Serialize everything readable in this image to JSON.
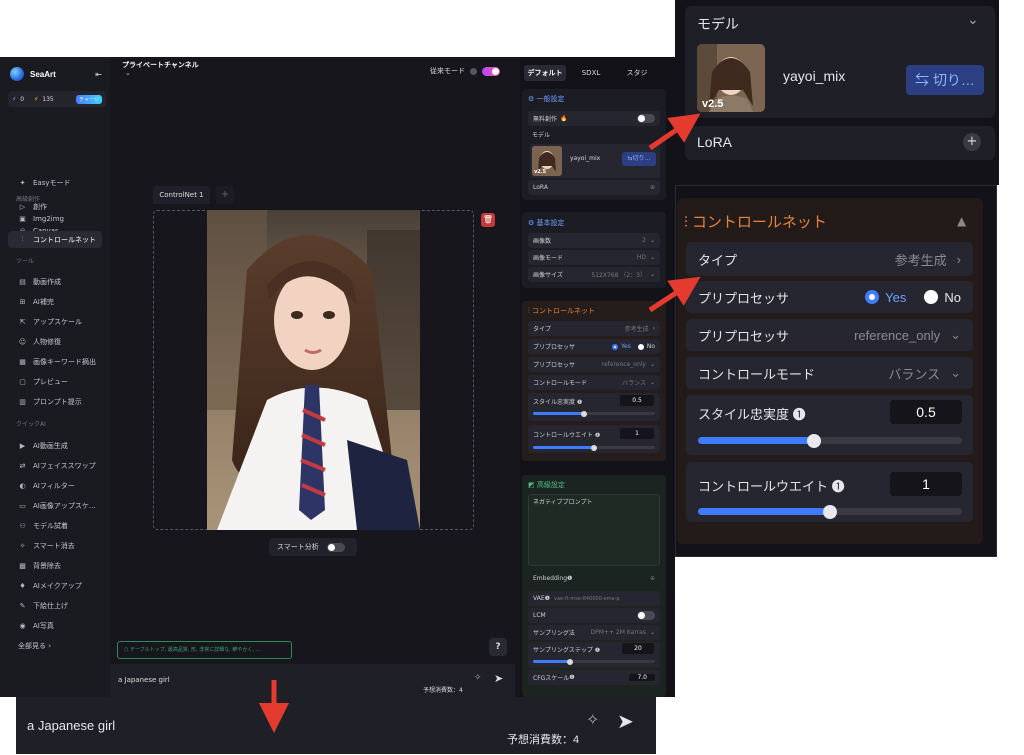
{
  "sidebar": {
    "brand": "SeaArt",
    "collapse_icon": "collapse-icon",
    "credits": {
      "a": "0",
      "b": "135",
      "charge": "チャージ"
    },
    "items": [
      {
        "label": "Easyモード",
        "icon": "sparkle-icon"
      },
      {
        "label": "創作",
        "icon": "play-icon"
      },
      {
        "label": "Canvas",
        "icon": "canvas-icon"
      }
    ],
    "section_advanced": "高級創作",
    "advanced_items": [
      {
        "label": "Img2img",
        "icon": "img2img-icon"
      },
      {
        "label": "コントロールネット",
        "icon": "sliders-icon"
      }
    ],
    "section_tools": "ツール",
    "tool_items": [
      {
        "label": "動画作成",
        "icon": "video-icon"
      },
      {
        "label": "AI補完",
        "icon": "expand-icon"
      },
      {
        "label": "アップスケール",
        "icon": "upscale-icon"
      },
      {
        "label": "人物修復",
        "icon": "face-icon"
      },
      {
        "label": "画像キーワード摘出",
        "icon": "keyword-icon"
      },
      {
        "label": "プレビュー",
        "icon": "preview-icon"
      },
      {
        "label": "プロンプト提示",
        "icon": "prompt-icon"
      }
    ],
    "section_quick": "クイックAI",
    "quick_items": [
      {
        "label": "AI動画生成",
        "icon": "video-gen-icon"
      },
      {
        "label": "AIフェイススワップ",
        "icon": "swap-icon"
      },
      {
        "label": "AIフィルター",
        "icon": "filter-icon"
      },
      {
        "label": "AI画像アップスケ…",
        "icon": "upscale-ai-icon"
      },
      {
        "label": "モデル試着",
        "icon": "shirt-icon"
      },
      {
        "label": "スマート消去",
        "icon": "eraser-icon"
      },
      {
        "label": "背景除去",
        "icon": "bg-remove-icon"
      },
      {
        "label": "AIメイクアップ",
        "icon": "makeup-icon"
      },
      {
        "label": "下絵仕上げ",
        "icon": "sketch-icon"
      },
      {
        "label": "AI写真",
        "icon": "camera-icon"
      }
    ],
    "see_all": "全部見る ›"
  },
  "topbar": {
    "channel": "プライベートチャンネル",
    "mode_label": "従来モード"
  },
  "canvas": {
    "tab_label": "ControlNet 1",
    "add_tab": "+",
    "smart_label": "スマート分析",
    "hint": "テーブルトップ, 最高品質, 形, 非常に詳細な, 鮮やかく, …",
    "help": "?"
  },
  "prompt": {
    "text": "a Japanese girl",
    "cost": "予想消費数：4"
  },
  "right_panel": {
    "tabs": [
      "デフォルト",
      "SDXL",
      "スタジ"
    ],
    "general": {
      "title": "一般設定",
      "free_label": "無料創作",
      "model_label": "モデル",
      "model_name": "yayoi_mix",
      "model_version": "v2.5",
      "switch_label": "切り…",
      "lora_label": "LoRA"
    },
    "basic": {
      "title": "基本設定",
      "rows": [
        {
          "label": "画像数",
          "value": "2"
        },
        {
          "label": "画像モード",
          "value": "HD"
        },
        {
          "label": "画像サイズ",
          "value": "512X768 （2：3）"
        }
      ]
    },
    "controlnet": {
      "title": "コントロールネット",
      "type_label": "タイプ",
      "type_value": "参考生成",
      "pre_label": "プリプロセッサ",
      "yes": "Yes",
      "no": "No",
      "pre2_label": "プリプロセッサ",
      "pre2_value": "reference_only",
      "mode_label": "コントロールモード",
      "mode_value": "バランス",
      "style_label": "スタイル忠実度",
      "style_value": "0.5",
      "style_level": 0.42,
      "weight_label": "コントロールウエイト",
      "weight_value": "1",
      "weight_level": 0.5
    },
    "advanced": {
      "title": "高級設定",
      "negative_label": "ネガティブプロンプト",
      "embedding_label": "Embedding",
      "vae_label": "VAE",
      "vae_value": "vae-ft-mse-840000-ema-p",
      "lcm_label": "LCM",
      "sampler_label": "サンプリング法",
      "sampler_value": "DPM++ 2M Karras",
      "steps_label": "サンプリングステップ",
      "steps_value": "20",
      "steps_level": 0.3,
      "cfg_label": "CFGスケール",
      "cfg_value": "7.0"
    }
  },
  "zoom_model": {
    "model_label": "モデル",
    "model_name": "yayoi_mix",
    "model_version": "v2.5",
    "switch_label": "切り…",
    "lora_label": "LoRA",
    "lora_add": "+"
  },
  "zoom_controlnet": {
    "title": "コントロールネット",
    "type_label": "タイプ",
    "type_value": "参考生成",
    "pre_label": "プリプロセッサ",
    "yes": "Yes",
    "no": "No",
    "pre2_label": "プリプロセッサ",
    "pre2_value": "reference_only",
    "mode_label": "コントロールモード",
    "mode_value": "バランス",
    "style_label": "スタイル忠実度",
    "style_value": "0.5",
    "style_level": 0.44,
    "weight_label": "コントロールウエイト",
    "weight_value": "1",
    "weight_level": 0.5
  },
  "zoom_prompt": {
    "text": "a Japanese girl",
    "cost": "予想消費数：4"
  },
  "colors": {
    "accent_blue": "#3f7cff",
    "accent_orange": "#e8833a",
    "arrow_red": "#e53a2e"
  }
}
